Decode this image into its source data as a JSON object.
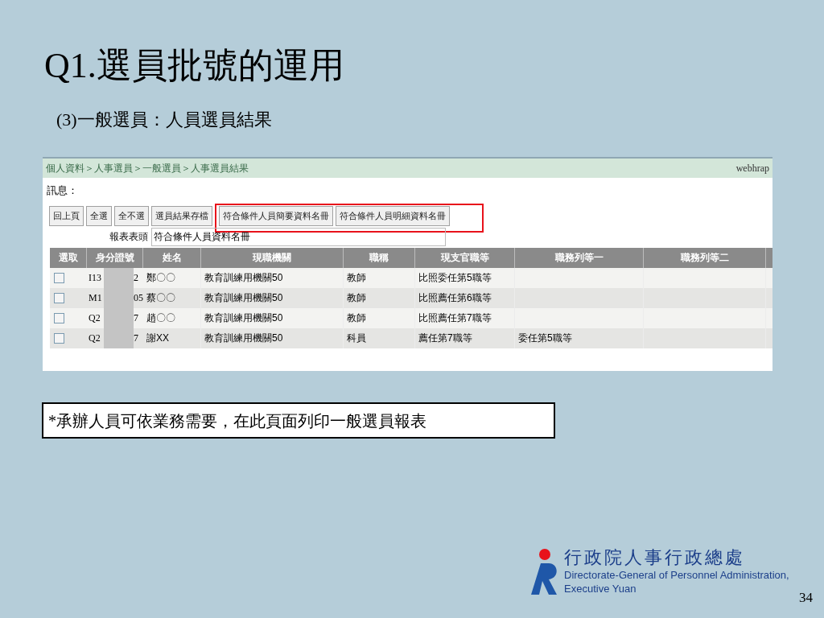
{
  "slide": {
    "title": "Q1.選員批號的運用",
    "subtitle": "(3)一般選員：人員選員結果",
    "page_number": "34"
  },
  "screen": {
    "breadcrumb": "個人資料＞人事選員＞一般選員＞人事選員結果",
    "system": "webhrap",
    "message_label": "訊息：",
    "buttons": [
      {
        "label": "回上頁",
        "highlighted": false
      },
      {
        "label": "全選",
        "highlighted": false
      },
      {
        "label": "全不選",
        "highlighted": false
      },
      {
        "label": "選員結果存檔",
        "highlighted": false
      },
      {
        "label": "符合條件人員簡要資料名冊",
        "highlighted": true
      },
      {
        "label": "符合條件人員明細資料名冊",
        "highlighted": true
      }
    ],
    "report_header": {
      "label": "報表表頭",
      "value": "符合條件人員資料名冊"
    },
    "table": {
      "columns": [
        "選取",
        "身分證號",
        "姓名",
        "現職機關",
        "職稱",
        "現支官職等",
        "職務列等一",
        "職務列等二"
      ],
      "rows": [
        {
          "checked": false,
          "id_start": "I13",
          "id_end": "2",
          "name": "鄭〇〇",
          "agency": "教育訓練用機關50",
          "title": "教師",
          "grade": "比照委任第5職等",
          "rank_1": "",
          "rank_2": ""
        },
        {
          "checked": false,
          "id_start": "M1",
          "id_end": "05",
          "name": "蔡〇〇",
          "agency": "教育訓練用機關50",
          "title": "教師",
          "grade": "比照薦任第6職等",
          "rank_1": "",
          "rank_2": ""
        },
        {
          "checked": false,
          "id_start": "Q2",
          "id_end": "7",
          "name": "趙〇〇",
          "agency": "教育訓練用機關50",
          "title": "教師",
          "grade": "比照薦任第7職等",
          "rank_1": "",
          "rank_2": ""
        },
        {
          "checked": false,
          "id_start": "Q2",
          "id_end": "7",
          "name": "謝XX",
          "agency": "教育訓練用機關50",
          "title": "科員",
          "grade": "薦任第7職等",
          "rank_1": "委任第5職等",
          "rank_2": ""
        }
      ]
    }
  },
  "note": "*承辦人員可依業務需要，在此頁面列印一般選員報表",
  "logo": {
    "name_zh": "行政院人事行政總處",
    "name_en_1": "Directorate-General of Personnel Administration,",
    "name_en_2": "Executive Yuan"
  }
}
